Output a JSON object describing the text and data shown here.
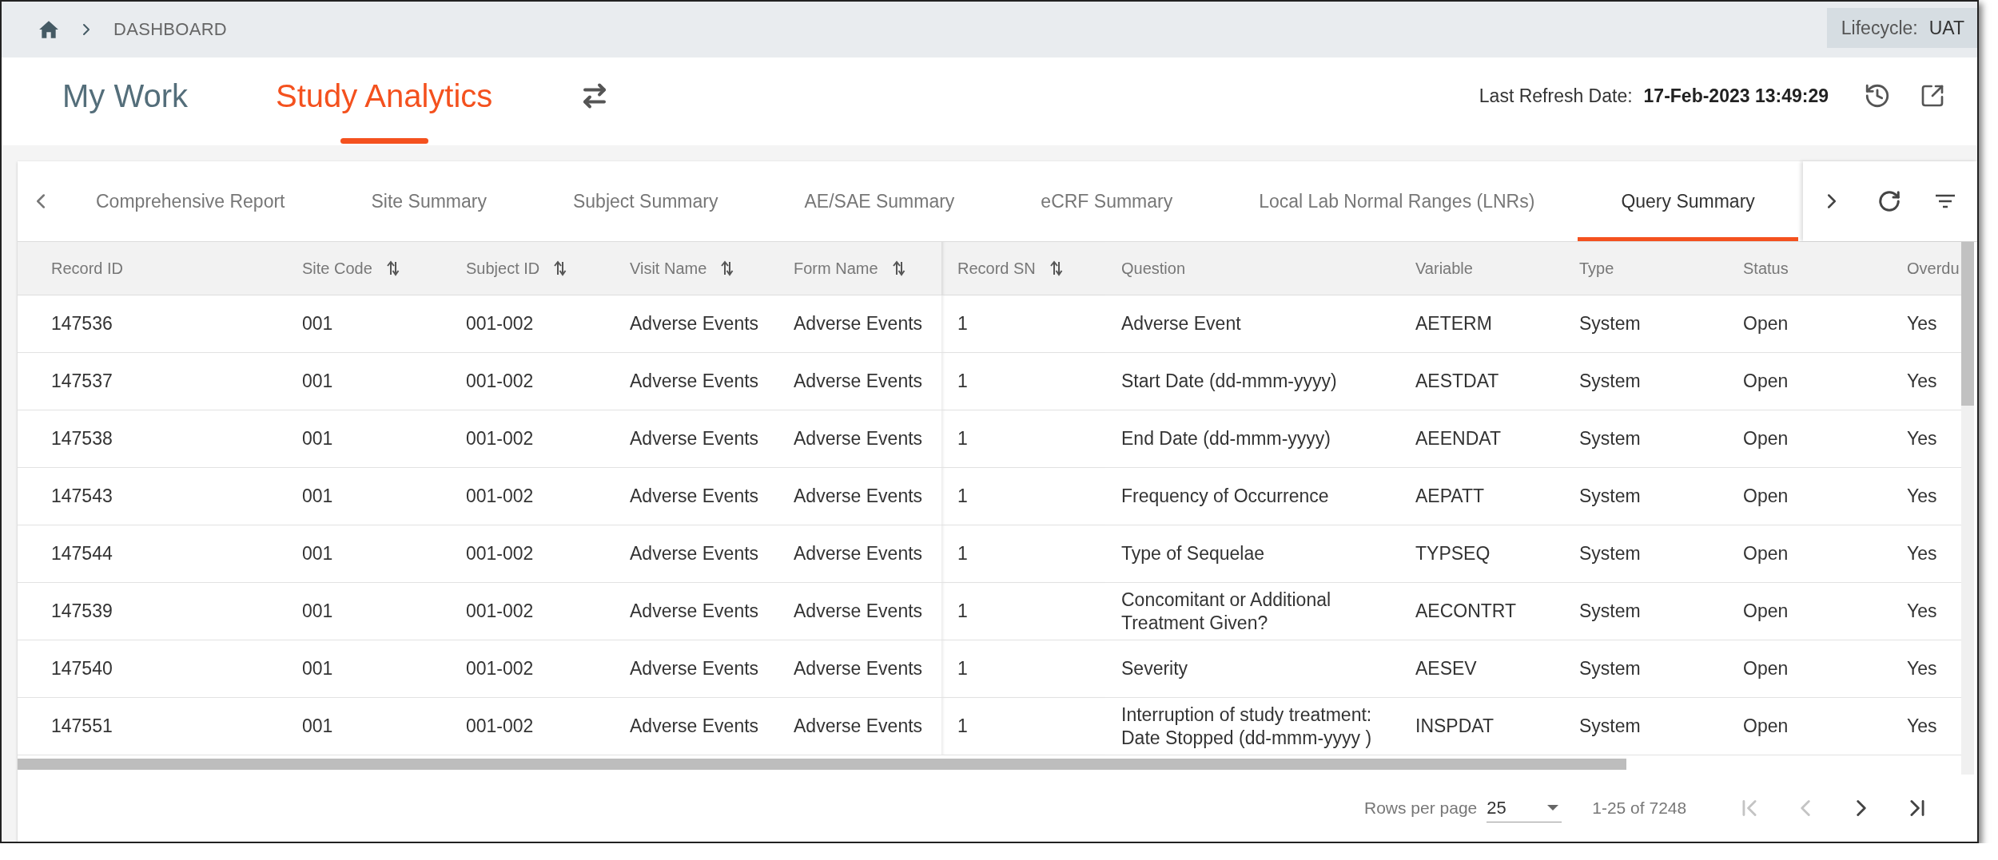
{
  "breadcrumb": {
    "items": [
      "DASHBOARD"
    ]
  },
  "lifecycle": {
    "label": "Lifecycle:",
    "value": "UAT"
  },
  "nav_tabs": [
    {
      "label": "My Work",
      "selected": false
    },
    {
      "label": "Study Analytics",
      "selected": true
    }
  ],
  "last_refresh": {
    "label": "Last Refresh Date:",
    "value": "17-Feb-2023 13:49:29"
  },
  "report_tabs": [
    {
      "label": "Comprehensive Report",
      "selected": false
    },
    {
      "label": "Site Summary",
      "selected": false
    },
    {
      "label": "Subject Summary",
      "selected": false
    },
    {
      "label": "AE/SAE Summary",
      "selected": false
    },
    {
      "label": "eCRF Summary",
      "selected": false
    },
    {
      "label": "Local Lab Normal Ranges (LNRs)",
      "selected": false
    },
    {
      "label": "Query Summary",
      "selected": true
    }
  ],
  "table": {
    "columns": [
      {
        "label": "Record ID",
        "sortable": false
      },
      {
        "label": "Site Code",
        "sortable": true
      },
      {
        "label": "Subject ID",
        "sortable": true
      },
      {
        "label": "Visit Name",
        "sortable": true
      },
      {
        "label": "Form Name",
        "sortable": true
      },
      {
        "label": "Record SN",
        "sortable": true
      },
      {
        "label": "Question",
        "sortable": false
      },
      {
        "label": "Variable",
        "sortable": false
      },
      {
        "label": "Type",
        "sortable": false
      },
      {
        "label": "Status",
        "sortable": false
      },
      {
        "label": "Overdu",
        "sortable": false
      }
    ],
    "rows": [
      [
        "147536",
        "001",
        "001-002",
        "Adverse Events",
        "Adverse Events",
        "1",
        "Adverse Event",
        "AETERM",
        "System",
        "Open",
        "Yes"
      ],
      [
        "147537",
        "001",
        "001-002",
        "Adverse Events",
        "Adverse Events",
        "1",
        "Start Date (dd-mmm-yyyy)",
        "AESTDAT",
        "System",
        "Open",
        "Yes"
      ],
      [
        "147538",
        "001",
        "001-002",
        "Adverse Events",
        "Adverse Events",
        "1",
        "End Date (dd-mmm-yyyy)",
        "AEENDAT",
        "System",
        "Open",
        "Yes"
      ],
      [
        "147543",
        "001",
        "001-002",
        "Adverse Events",
        "Adverse Events",
        "1",
        "Frequency of Occurrence",
        "AEPATT",
        "System",
        "Open",
        "Yes"
      ],
      [
        "147544",
        "001",
        "001-002",
        "Adverse Events",
        "Adverse Events",
        "1",
        "Type of Sequelae",
        "TYPSEQ",
        "System",
        "Open",
        "Yes"
      ],
      [
        "147539",
        "001",
        "001-002",
        "Adverse Events",
        "Adverse Events",
        "1",
        "Concomitant or Additional Treatment Given?",
        "AECONTRT",
        "System",
        "Open",
        "Yes"
      ],
      [
        "147540",
        "001",
        "001-002",
        "Adverse Events",
        "Adverse Events",
        "1",
        "Severity",
        "AESEV",
        "System",
        "Open",
        "Yes"
      ],
      [
        "147551",
        "001",
        "001-002",
        "Adverse Events",
        "Adverse Events",
        "1",
        "Interruption of study treatment: Date Stopped (dd-mmm-yyyy )",
        "INSPDAT",
        "System",
        "Open",
        "Yes"
      ]
    ]
  },
  "pagination": {
    "rows_per_page_label": "Rows per page",
    "rows_per_page": "25",
    "range": "1-25 of 7248",
    "buttons": [
      {
        "kind": "first",
        "disabled": true
      },
      {
        "kind": "prev",
        "disabled": true
      },
      {
        "kind": "next",
        "disabled": false
      },
      {
        "kind": "last",
        "disabled": false
      }
    ]
  }
}
